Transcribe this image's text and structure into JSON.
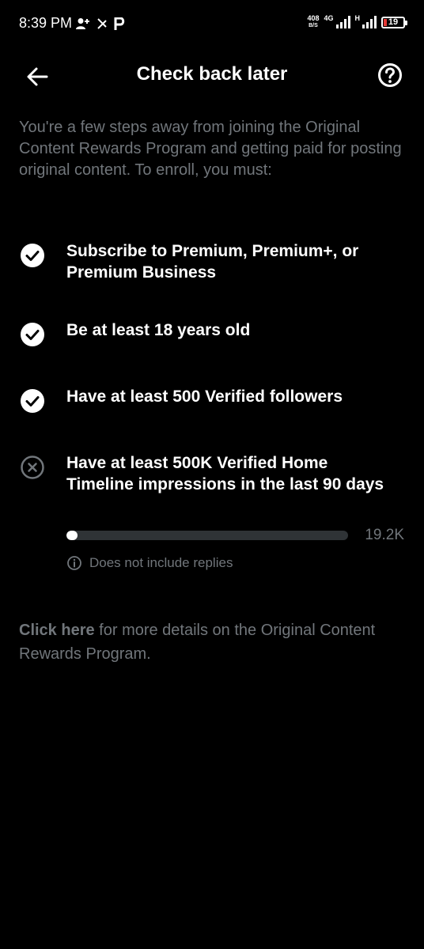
{
  "status_bar": {
    "time": "8:39 PM",
    "left_icons": [
      "person-add-icon",
      "sync-icon",
      "paytm-p-icon"
    ],
    "net_speed_value": "408",
    "net_speed_unit": "B/S",
    "network_label_1": "4G",
    "network_label_2": "H",
    "battery_level": "19",
    "battery_color": "#e53935"
  },
  "header": {
    "title": "Check back later",
    "back_icon": "arrow-left-icon",
    "help_icon": "help-circle-icon"
  },
  "intro": "You're a few steps away from joining the Original Content Rewards Program and getting paid for posting original content. To enroll, you must:",
  "requirements": [
    {
      "text": "Subscribe to Premium, Premium+, or Premium Business",
      "met": true
    },
    {
      "text": "Be at least 18 years old",
      "met": true
    },
    {
      "text": "Have at least 500 Verified followers",
      "met": true
    },
    {
      "text": "Have at least 500K Verified Home Timeline impressions in the last 90 days",
      "met": false
    }
  ],
  "progress": {
    "value_label": "19.2K",
    "fraction": 0.0384
  },
  "note": "Does not include replies",
  "footer": {
    "link_text": "Click here",
    "rest_text": " for more details on the Original Content Rewards Program."
  },
  "colors": {
    "background": "#000000",
    "text_primary": "#ffffff",
    "text_secondary": "#71767b",
    "track": "#2f3336",
    "unmet_icon": "#71767b"
  }
}
